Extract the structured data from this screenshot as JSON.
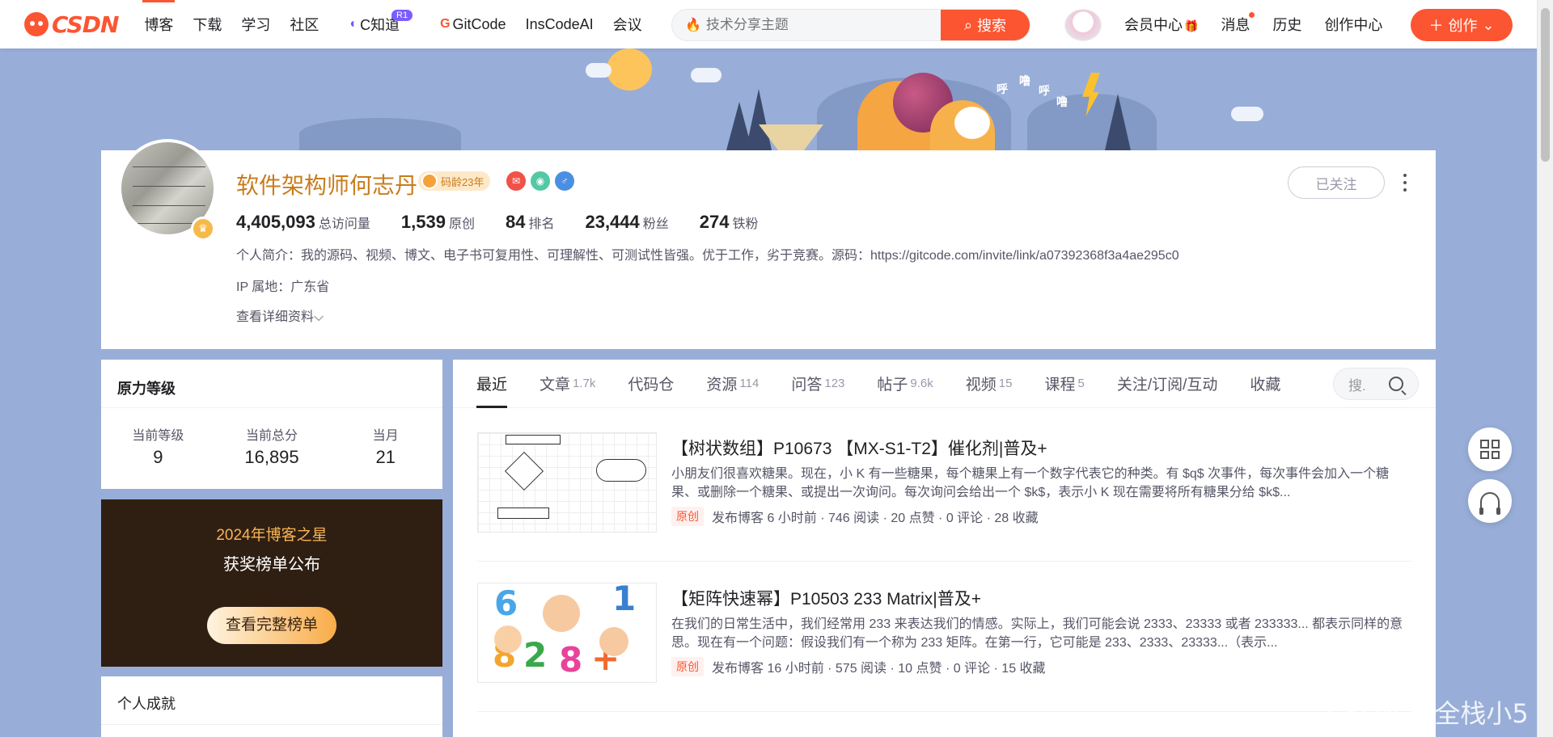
{
  "nav": {
    "logo": "CSDN",
    "items": [
      "博客",
      "下载",
      "学习",
      "社区",
      "C知道",
      "GitCode",
      "InsCodeAI",
      "会议"
    ],
    "badge": "R1",
    "search_placeholder": "技术分享主题",
    "search_button": "搜索",
    "right_links": [
      "会员中心",
      "消息",
      "历史",
      "创作中心"
    ],
    "create_button": "创作"
  },
  "profile": {
    "name": "软件架构师何志丹",
    "code_age": "码龄23年",
    "stats": [
      {
        "value": "4,405,093",
        "label": "总访问量"
      },
      {
        "value": "1,539",
        "label": "原创"
      },
      {
        "value": "84",
        "label": "排名"
      },
      {
        "value": "23,444",
        "label": "粉丝"
      },
      {
        "value": "274",
        "label": "铁粉"
      }
    ],
    "intro": "个人简介：我的源码、视频、博文、电子书可复用性、可理解性、可测试性皆强。优于工作，劣于竞赛。源码：https://gitcode.com/invite/link/a07392368f3a4ae295c0",
    "ip": "IP 属地：广东省",
    "detail_link": "查看详细资料",
    "follow_button": "已关注"
  },
  "level": {
    "title": "原力等级",
    "cols": [
      {
        "label": "当前等级",
        "value": "9"
      },
      {
        "label": "当前总分",
        "value": "16,895"
      },
      {
        "label": "当月",
        "value": "21"
      }
    ]
  },
  "star": {
    "title": "2024年博客之星",
    "subtitle": "获奖榜单公布",
    "button": "查看完整榜单"
  },
  "achievement": {
    "title": "个人成就"
  },
  "tabs": [
    {
      "label": "最近",
      "count": ""
    },
    {
      "label": "文章",
      "count": "1.7k"
    },
    {
      "label": "代码仓",
      "count": ""
    },
    {
      "label": "资源",
      "count": "114"
    },
    {
      "label": "问答",
      "count": "123"
    },
    {
      "label": "帖子",
      "count": "9.6k"
    },
    {
      "label": "视频",
      "count": "15"
    },
    {
      "label": "课程",
      "count": "5"
    },
    {
      "label": "关注/订阅/互动",
      "count": ""
    },
    {
      "label": "收藏",
      "count": ""
    }
  ],
  "tab_search_placeholder": "搜.",
  "articles": [
    {
      "title": "【树状数组】P10673 【MX-S1-T2】催化剂|普及+",
      "desc": "小朋友们很喜欢糖果。现在，小 K 有一些糖果，每个糖果上有一个数字代表它的种类。有 $q$ 次事件，每次事件会加入一个糖果、或删除一个糖果、或提出一次询问。每次询问会给出一个 $k$，表示小 K 现在需要将所有糖果分给 $k$...",
      "tag": "原创",
      "meta": "发布博客 6 小时前 · 746 阅读 · 20 点赞 · 0 评论 · 28 收藏"
    },
    {
      "title": "【矩阵快速幂】P10503 233 Matrix|普及+",
      "desc": "在我们的日常生活中，我们经常用 233 来表达我们的情感。实际上，我们可能会说 2333、23333 或者 233333... 都表示同样的意思。现在有一个问题：假设我们有一个称为 233 矩阵。在第一行，它可能是 233、2333、23333...（表示...",
      "tag": "原创",
      "meta": "发布博客 16 小时前 · 575 阅读 · 10 点赞 · 0 评论 · 15 收藏"
    }
  ],
  "watermark": "CSDN @全栈小5"
}
